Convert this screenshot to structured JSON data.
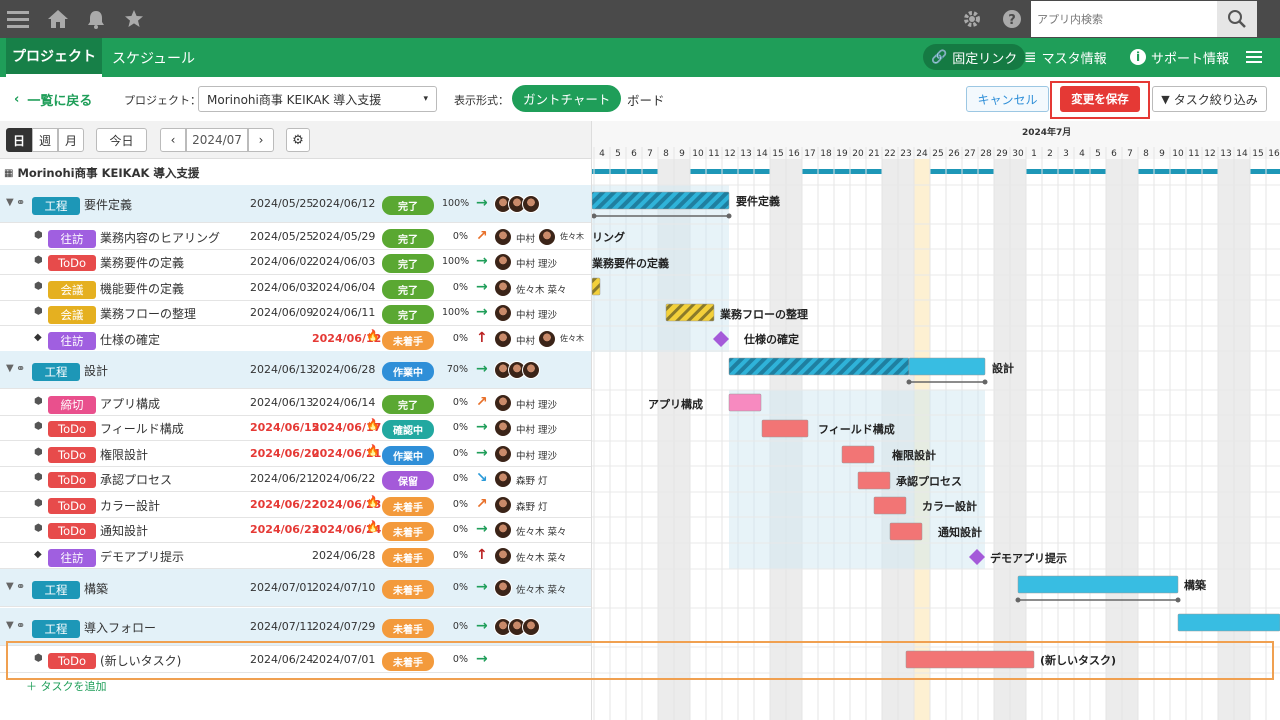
{
  "topbar": {
    "search_placeholder": "アプリ内検索",
    "icons": [
      "menu-icon",
      "home-icon",
      "bell-icon",
      "star-icon",
      "gear-icon",
      "help-icon",
      "search-icon"
    ]
  },
  "navbar": {
    "tabs": [
      {
        "label": "プロジェクト",
        "active": true
      },
      {
        "label": "スケジュール",
        "active": false
      }
    ],
    "links": [
      {
        "label": "固定リンク"
      },
      {
        "label": "マスタ情報"
      },
      {
        "label": "サポート情報"
      }
    ]
  },
  "toolbar": {
    "back_label": "一覧に戻る",
    "project_label": "プロジェクト：",
    "project_value": "Morinohi商事 KEIKAK 導入支援",
    "view_label": "表示形式：",
    "view_gantt": "ガントチャート",
    "view_board": "ボード",
    "cancel_label": "キャンセル",
    "save_label": "変更を保存",
    "filter_label": "タスク絞り込み"
  },
  "subtoolbar": {
    "day": "日",
    "week": "週",
    "month": "月",
    "today": "今日",
    "month_value": "2024/07"
  },
  "timeline": {
    "month_label": "2024年7月",
    "days": [
      "4",
      "5",
      "6",
      "7",
      "8",
      "9",
      "10",
      "11",
      "12",
      "13",
      "14",
      "15",
      "16",
      "17",
      "18",
      "19",
      "20",
      "21",
      "22",
      "23",
      "24",
      "25",
      "26",
      "27",
      "28",
      "29",
      "30",
      "1",
      "2",
      "3",
      "4",
      "5",
      "6",
      "7",
      "8",
      "9",
      "10",
      "11",
      "12",
      "13",
      "14",
      "15",
      "16"
    ]
  },
  "project_title": "Morinohi商事 KEIKAK 導入支援",
  "add_task_label": "＋ タスクを追加",
  "colors": {
    "green": "#1f9e59",
    "done": "#5aa832",
    "inprogress": "#2f8fd8",
    "notstarted": "#f39a3c",
    "review": "#22a8a0",
    "hold": "#a45ad9",
    "tag_phase": "#1d97b7",
    "tag_visit": "#a05fe0",
    "tag_todo": "#e74b4b",
    "tag_meeting": "#e5b020",
    "tag_deadline": "#e9508d"
  },
  "rows": [
    {
      "kind": "phase",
      "tag": "工程",
      "tagc": "tag_phase",
      "name": "要件定義",
      "start": "2024/05/25",
      "end": "2024/06/12",
      "status": "完了",
      "sc": "done",
      "pct": "100%",
      "arrow": "→",
      "ac": "#1f9e59",
      "who": "",
      "avs": 3
    },
    {
      "kind": "task",
      "tag": "往訪",
      "tagc": "tag_visit",
      "name": "業務内容のヒアリング",
      "start": "2024/05/25",
      "end": "2024/05/29",
      "status": "完了",
      "sc": "done",
      "pct": "0%",
      "arrow": "↗",
      "ac": "#e8702a",
      "who": "中村",
      "who2": "佐々木",
      "avs": 2
    },
    {
      "kind": "task",
      "tag": "ToDo",
      "tagc": "tag_todo",
      "name": "業務要件の定義",
      "start": "2024/06/02",
      "end": "2024/06/03",
      "status": "完了",
      "sc": "done",
      "pct": "100%",
      "arrow": "→",
      "ac": "#1f9e59",
      "who": "中村 理沙",
      "avs": 1
    },
    {
      "kind": "task",
      "tag": "会議",
      "tagc": "tag_meeting",
      "name": "機能要件の定義",
      "start": "2024/06/03",
      "end": "2024/06/04",
      "status": "完了",
      "sc": "done",
      "pct": "0%",
      "arrow": "→",
      "ac": "#1f9e59",
      "who": "佐々木 菜々",
      "avs": 1
    },
    {
      "kind": "task",
      "tag": "会議",
      "tagc": "tag_meeting",
      "name": "業務フローの整理",
      "start": "2024/06/09",
      "end": "2024/06/11",
      "status": "完了",
      "sc": "done",
      "pct": "100%",
      "arrow": "→",
      "ac": "#1f9e59",
      "who": "中村 理沙",
      "avs": 1
    },
    {
      "kind": "milestone",
      "tag": "往訪",
      "tagc": "tag_visit",
      "name": "仕様の確定",
      "start": "",
      "end": "2024/06/12",
      "endred": true,
      "fire": true,
      "status": "未着手",
      "sc": "notstarted",
      "pct": "0%",
      "arrow": "↑",
      "ac": "#b22",
      "who": "中村",
      "who2": "佐々木",
      "avs": 2
    },
    {
      "kind": "phase",
      "tag": "工程",
      "tagc": "tag_phase",
      "name": "設計",
      "start": "2024/06/13",
      "end": "2024/06/28",
      "status": "作業中",
      "sc": "inprogress",
      "pct": "70%",
      "arrow": "→",
      "ac": "#1f9e59",
      "who": "",
      "avs": 3
    },
    {
      "kind": "task",
      "tag": "締切",
      "tagc": "tag_deadline",
      "name": "アプリ構成",
      "start": "2024/06/13",
      "end": "2024/06/14",
      "status": "完了",
      "sc": "done",
      "pct": "0%",
      "arrow": "↗",
      "ac": "#e8702a",
      "who": "中村 理沙",
      "avs": 1
    },
    {
      "kind": "task",
      "tag": "ToDo",
      "tagc": "tag_todo",
      "name": "フィールド構成",
      "start": "2024/06/15",
      "end": "2024/06/17",
      "startred": true,
      "endred": true,
      "fire": true,
      "status": "確認中",
      "sc": "review",
      "pct": "0%",
      "arrow": "→",
      "ac": "#1f9e59",
      "who": "中村 理沙",
      "avs": 1
    },
    {
      "kind": "task",
      "tag": "ToDo",
      "tagc": "tag_todo",
      "name": "権限設計",
      "start": "2024/06/20",
      "end": "2024/06/21",
      "startred": true,
      "endred": true,
      "fire": true,
      "status": "作業中",
      "sc": "inprogress",
      "pct": "0%",
      "arrow": "→",
      "ac": "#1f9e59",
      "who": "中村 理沙",
      "avs": 1
    },
    {
      "kind": "task",
      "tag": "ToDo",
      "tagc": "tag_todo",
      "name": "承認プロセス",
      "start": "2024/06/21",
      "end": "2024/06/22",
      "status": "保留",
      "sc": "hold",
      "pct": "0%",
      "arrow": "↘",
      "ac": "#2a9ad8",
      "who": "森野 灯",
      "avs": 1
    },
    {
      "kind": "task",
      "tag": "ToDo",
      "tagc": "tag_todo",
      "name": "カラー設計",
      "start": "2024/06/22",
      "end": "2024/06/23",
      "startred": true,
      "endred": true,
      "fire": true,
      "status": "未着手",
      "sc": "notstarted",
      "pct": "0%",
      "arrow": "↗",
      "ac": "#e8702a",
      "who": "森野 灯",
      "avs": 1
    },
    {
      "kind": "task",
      "tag": "ToDo",
      "tagc": "tag_todo",
      "name": "通知設計",
      "start": "2024/06/23",
      "end": "2024/06/24",
      "startred": true,
      "endred": true,
      "fire": true,
      "status": "未着手",
      "sc": "notstarted",
      "pct": "0%",
      "arrow": "→",
      "ac": "#1f9e59",
      "who": "佐々木 菜々",
      "avs": 1
    },
    {
      "kind": "milestone",
      "tag": "往訪",
      "tagc": "tag_visit",
      "name": "デモアプリ提示",
      "start": "",
      "end": "2024/06/28",
      "status": "未着手",
      "sc": "notstarted",
      "pct": "0%",
      "arrow": "↑",
      "ac": "#b22",
      "who": "佐々木 菜々",
      "avs": 1
    },
    {
      "kind": "phase",
      "tag": "工程",
      "tagc": "tag_phase",
      "name": "構築",
      "start": "2024/07/01",
      "end": "2024/07/10",
      "status": "未着手",
      "sc": "notstarted",
      "pct": "0%",
      "arrow": "→",
      "ac": "#1f9e59",
      "who": "佐々木 菜々",
      "avs": 1
    },
    {
      "kind": "phase",
      "tag": "工程",
      "tagc": "tag_phase",
      "name": "導入フォロー",
      "start": "2024/07/11",
      "end": "2024/07/29",
      "status": "未着手",
      "sc": "notstarted",
      "pct": "0%",
      "arrow": "→",
      "ac": "#1f9e59",
      "who": "",
      "avs": 3
    },
    {
      "kind": "task",
      "tag": "ToDo",
      "tagc": "tag_todo",
      "name": "(新しいタスク)",
      "start": "2024/06/24",
      "end": "2024/07/01",
      "status": "未着手",
      "sc": "notstarted",
      "pct": "0%",
      "arrow": "→",
      "ac": "#1f9e59",
      "who": "",
      "avs": 0
    }
  ],
  "gantt_labels": [
    "要件定義",
    "リング",
    "業務要件の定義",
    "",
    "業務フローの整理",
    "仕様の確定",
    "設計",
    "アプリ構成",
    "フィールド構成",
    "権限設計",
    "承認プロセス",
    "カラー設計",
    "通知設計",
    "デモアプリ提示",
    "構築",
    "",
    "(新しいタスク)"
  ]
}
